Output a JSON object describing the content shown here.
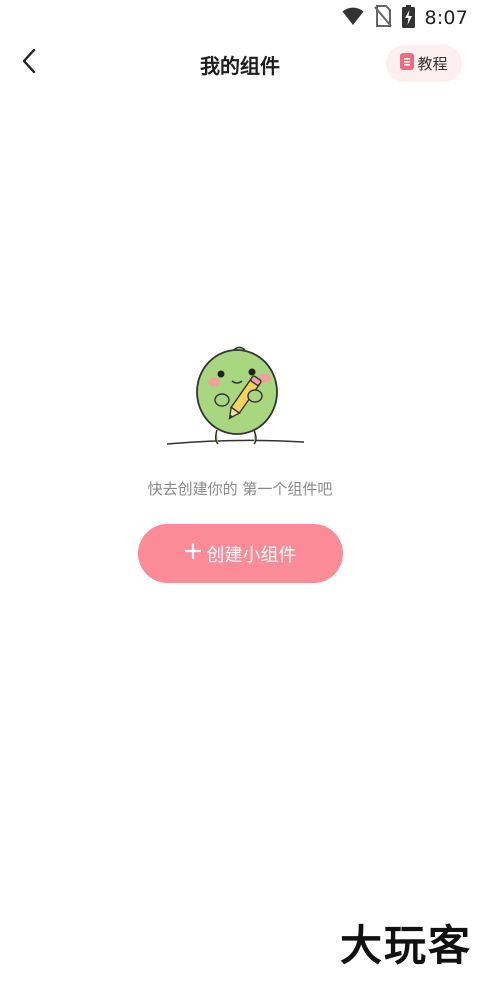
{
  "status_bar": {
    "time": "8:07",
    "icons": [
      "wifi-icon",
      "no-sim-icon",
      "battery-charging-icon"
    ]
  },
  "header": {
    "title": "我的组件",
    "back_icon": "chevron-left-icon",
    "tutorial_label": "教程",
    "tutorial_icon": "document-icon"
  },
  "empty_state": {
    "illustration": "green-blob-holding-pencil",
    "message": "快去创建你的 第一个组件吧"
  },
  "create_button": {
    "label": "创建小组件",
    "icon": "plus-icon"
  },
  "watermark": "大玩客",
  "colors": {
    "accent": "#fc8b98",
    "tutorial_bg": "#fdeef0",
    "tutorial_icon": "#f26a80",
    "mascot_green": "#a8d77f"
  }
}
